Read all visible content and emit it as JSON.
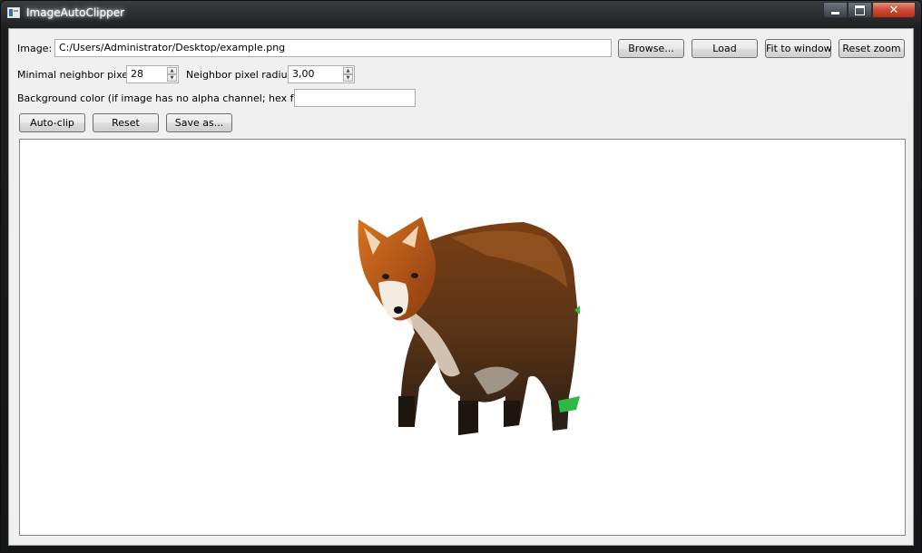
{
  "window": {
    "title": "ImageAutoClipper"
  },
  "image_row": {
    "label": "Image:",
    "path": "C:/Users/Administrator/Desktop/example.png",
    "browse_label": "Browse...",
    "load_label": "Load",
    "fit_label": "Fit to window",
    "reset_zoom_label": "Reset zoom"
  },
  "params_row": {
    "min_neighbor_label": "Minimal neighbor pixels:",
    "min_neighbor_value": "28",
    "radius_label": "Neighbor pixel radius:",
    "radius_value": "3,00"
  },
  "bg_row": {
    "label": "Background color (if image has no alpha channel; hex format):",
    "value": ""
  },
  "actions": {
    "autoclip_label": "Auto-clip",
    "reset_label": "Reset",
    "save_label": "Save as..."
  },
  "canvas": {
    "image_subject": "fox-image"
  },
  "colors": {
    "client_bg": "#f0f0f0",
    "canvas_bg": "#ffffff",
    "close_button": "#c7462d",
    "fox_fur": "#a4521e"
  }
}
